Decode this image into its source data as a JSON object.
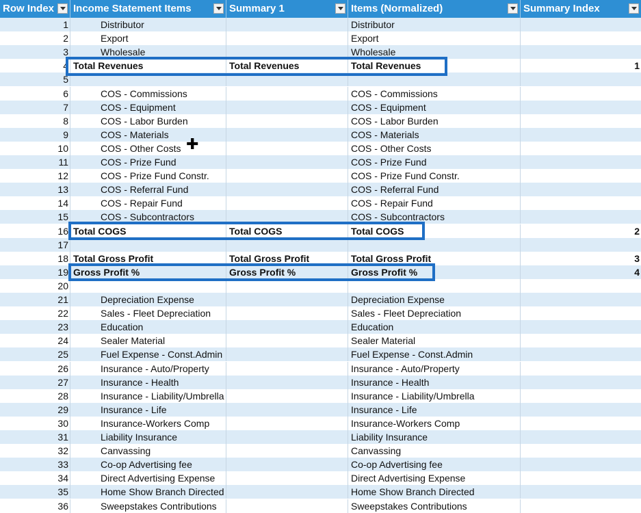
{
  "headers": [
    "Row Index",
    "Income Statement Items",
    "Summary 1",
    "Items (Normalized)",
    "Summary Index"
  ],
  "rows": [
    {
      "idx": "1",
      "item": "Distributor",
      "sum": "",
      "norm": "Distributor",
      "sidx": "",
      "bold": false
    },
    {
      "idx": "2",
      "item": "Export",
      "sum": "",
      "norm": "Export",
      "sidx": "",
      "bold": false
    },
    {
      "idx": "3",
      "item": "Wholesale",
      "sum": "",
      "norm": "Wholesale",
      "sidx": "",
      "bold": false
    },
    {
      "idx": "4",
      "item": "Total Revenues",
      "sum": "Total Revenues",
      "norm": "Total Revenues",
      "sidx": "1",
      "bold": true
    },
    {
      "idx": "5",
      "item": "",
      "sum": "",
      "norm": "",
      "sidx": "",
      "bold": false
    },
    {
      "idx": "6",
      "item": "COS - Commissions",
      "sum": "",
      "norm": "COS - Commissions",
      "sidx": "",
      "bold": false
    },
    {
      "idx": "7",
      "item": "COS - Equipment",
      "sum": "",
      "norm": "COS - Equipment",
      "sidx": "",
      "bold": false
    },
    {
      "idx": "8",
      "item": "COS - Labor Burden",
      "sum": "",
      "norm": "COS - Labor Burden",
      "sidx": "",
      "bold": false
    },
    {
      "idx": "9",
      "item": "COS - Materials",
      "sum": "",
      "norm": "COS - Materials",
      "sidx": "",
      "bold": false
    },
    {
      "idx": "10",
      "item": "COS - Other Costs",
      "sum": "",
      "norm": "COS - Other Costs",
      "sidx": "",
      "bold": false
    },
    {
      "idx": "11",
      "item": "COS - Prize Fund",
      "sum": "",
      "norm": "COS - Prize Fund",
      "sidx": "",
      "bold": false
    },
    {
      "idx": "12",
      "item": "COS - Prize Fund Constr.",
      "sum": "",
      "norm": "COS - Prize Fund Constr.",
      "sidx": "",
      "bold": false
    },
    {
      "idx": "13",
      "item": "COS - Referral Fund",
      "sum": "",
      "norm": "COS - Referral Fund",
      "sidx": "",
      "bold": false
    },
    {
      "idx": "14",
      "item": "COS - Repair Fund",
      "sum": "",
      "norm": "COS - Repair Fund",
      "sidx": "",
      "bold": false
    },
    {
      "idx": "15",
      "item": "COS - Subcontractors",
      "sum": "",
      "norm": "COS - Subcontractors",
      "sidx": "",
      "bold": false
    },
    {
      "idx": "16",
      "item": "Total COGS",
      "sum": "Total COGS",
      "norm": "Total COGS",
      "sidx": "2",
      "bold": true
    },
    {
      "idx": "17",
      "item": "",
      "sum": "",
      "norm": "",
      "sidx": "",
      "bold": false
    },
    {
      "idx": "18",
      "item": "Total Gross Profit",
      "sum": "Total Gross Profit",
      "norm": "Total Gross Profit",
      "sidx": "3",
      "bold": true
    },
    {
      "idx": "19",
      "item": "Gross Profit %",
      "sum": "Gross Profit %",
      "norm": "Gross Profit %",
      "sidx": "4",
      "bold": true
    },
    {
      "idx": "20",
      "item": "",
      "sum": "",
      "norm": "",
      "sidx": "",
      "bold": false
    },
    {
      "idx": "21",
      "item": "Depreciation Expense",
      "sum": "",
      "norm": "Depreciation Expense",
      "sidx": "",
      "bold": false
    },
    {
      "idx": "22",
      "item": "Sales - Fleet Depreciation",
      "sum": "",
      "norm": "Sales - Fleet Depreciation",
      "sidx": "",
      "bold": false
    },
    {
      "idx": "23",
      "item": "Education",
      "sum": "",
      "norm": "Education",
      "sidx": "",
      "bold": false
    },
    {
      "idx": "24",
      "item": "Sealer Material",
      "sum": "",
      "norm": "Sealer Material",
      "sidx": "",
      "bold": false
    },
    {
      "idx": "25",
      "item": "Fuel Expense - Const.Admin",
      "sum": "",
      "norm": "Fuel Expense - Const.Admin",
      "sidx": "",
      "bold": false
    },
    {
      "idx": "26",
      "item": "Insurance - Auto/Property",
      "sum": "",
      "norm": "Insurance - Auto/Property",
      "sidx": "",
      "bold": false
    },
    {
      "idx": "27",
      "item": "Insurance - Health",
      "sum": "",
      "norm": "Insurance - Health",
      "sidx": "",
      "bold": false
    },
    {
      "idx": "28",
      "item": "Insurance - Liability/Umbrella",
      "sum": "",
      "norm": "Insurance - Liability/Umbrella",
      "sidx": "",
      "bold": false
    },
    {
      "idx": "29",
      "item": "Insurance - Life",
      "sum": "",
      "norm": "Insurance - Life",
      "sidx": "",
      "bold": false
    },
    {
      "idx": "30",
      "item": "Insurance-Workers Comp",
      "sum": "",
      "norm": "Insurance-Workers Comp",
      "sidx": "",
      "bold": false
    },
    {
      "idx": "31",
      "item": "Liability Insurance",
      "sum": "",
      "norm": "Liability Insurance",
      "sidx": "",
      "bold": false
    },
    {
      "idx": "32",
      "item": "Canvassing",
      "sum": "",
      "norm": "Canvassing",
      "sidx": "",
      "bold": false
    },
    {
      "idx": "33",
      "item": "Co-op Advertising fee",
      "sum": "",
      "norm": "Co-op Advertising fee",
      "sidx": "",
      "bold": false
    },
    {
      "idx": "34",
      "item": "Direct Advertising Expense",
      "sum": "",
      "norm": "Direct Advertising Expense",
      "sidx": "",
      "bold": false
    },
    {
      "idx": "35",
      "item": "Home Show Branch Directed",
      "sum": "",
      "norm": "Home Show Branch Directed",
      "sidx": "",
      "bold": false
    },
    {
      "idx": "36",
      "item": "Sweepstakes Contributions",
      "sum": "",
      "norm": "Sweepstakes Contributions",
      "sidx": "",
      "bold": false
    }
  ],
  "highlighted_rows": [
    "4",
    "16",
    "19"
  ],
  "colors": {
    "header_bg": "#2e8fd4",
    "band": "#dcebf7",
    "highlight_border": "#1f6fc5"
  },
  "cursor_icon": "cell-select-cross-icon"
}
